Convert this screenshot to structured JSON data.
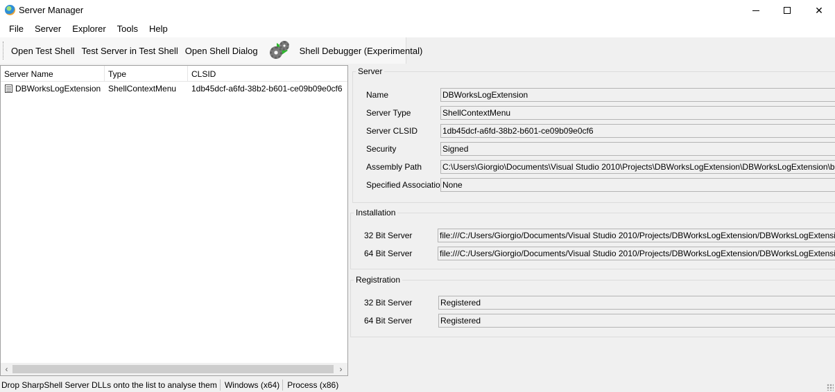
{
  "window": {
    "title": "Server Manager"
  },
  "menu": [
    "File",
    "Server",
    "Explorer",
    "Tools",
    "Help"
  ],
  "toolbar": {
    "open_test_shell": "Open Test Shell",
    "test_server": "Test Server in Test Shell",
    "open_shell_dialog": "Open Shell Dialog",
    "shell_debugger": "Shell Debugger (Experimental)"
  },
  "list": {
    "columns": [
      "Server Name",
      "Type",
      "CLSID"
    ],
    "rows": [
      {
        "name": "DBWorksLogExtension",
        "type": "ShellContextMenu",
        "clsid": "1db45dcf-a6fd-38b2-b601-ce09b09e0cf6"
      }
    ]
  },
  "server_group": {
    "title": "Server",
    "name_label": "Name",
    "name_value": "DBWorksLogExtension",
    "type_label": "Server Type",
    "type_value": "ShellContextMenu",
    "clsid_label": "Server CLSID",
    "clsid_value": "1db45dcf-a6fd-38b2-b601-ce09b09e0cf6",
    "security_label": "Security",
    "security_value": "Signed",
    "assembly_label": "Assembly Path",
    "assembly_value": "C:\\Users\\Giorgio\\Documents\\Visual Studio 2010\\Projects\\DBWorksLogExtension\\DBWorksLogExtension\\bin\\Debug\\",
    "assoc_label": "Specified Associations",
    "assoc_value": "None"
  },
  "installation_group": {
    "title": "Installation",
    "bit32_label": "32 Bit Server",
    "bit32_value": "file:///C:/Users/Giorgio/Documents/Visual Studio 2010/Projects/DBWorksLogExtension/DBWorksLogExtension/bin/De",
    "bit64_label": "64 Bit Server",
    "bit64_value": "file:///C:/Users/Giorgio/Documents/Visual Studio 2010/Projects/DBWorksLogExtension/DBWorksLogExtension/bin/De"
  },
  "registration_group": {
    "title": "Registration",
    "bit32_label": "32 Bit Server",
    "bit32_value": "Registered",
    "bit64_label": "64 Bit Server",
    "bit64_value": "Registered"
  },
  "status": {
    "hint": "Drop SharpShell Server DLLs onto the list to analyse them",
    "os": "Windows (x64)",
    "process": "Process (x86)"
  }
}
